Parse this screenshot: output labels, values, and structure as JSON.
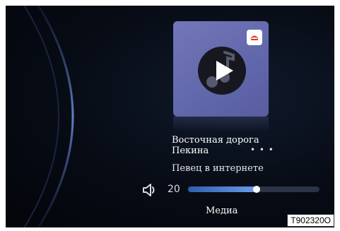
{
  "player": {
    "track_title": "Восточная дорога Пекина",
    "artist": "Певец в интернете",
    "more_label": "• • •",
    "app_logo_icon": "xmly-app-logo-icon",
    "play_icon": "play-icon",
    "disc_icon": "music-note-disc-icon"
  },
  "volume": {
    "icon": "speaker-icon",
    "value": "20",
    "level": 0.52
  },
  "source_label": "Медиа",
  "figure_code": "T902320O",
  "colors": {
    "background": "#070b14",
    "cover": "#6a6fb2",
    "accent": "#4a7fd0"
  }
}
